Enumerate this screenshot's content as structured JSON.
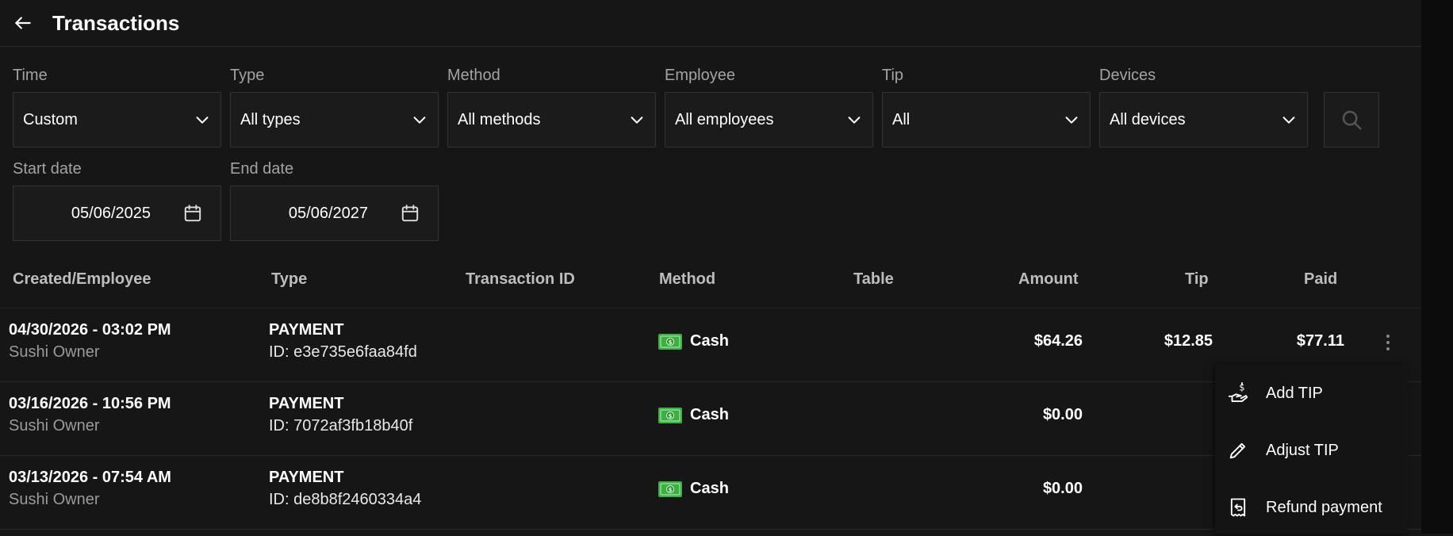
{
  "header": {
    "title": "Transactions"
  },
  "filters": [
    {
      "label": "Time",
      "value": "Custom"
    },
    {
      "label": "Type",
      "value": "All types"
    },
    {
      "label": "Method",
      "value": "All methods"
    },
    {
      "label": "Employee",
      "value": "All employees"
    },
    {
      "label": "Tip",
      "value": "All"
    },
    {
      "label": "Devices",
      "value": "All devices"
    }
  ],
  "dates": {
    "start": {
      "label": "Start date",
      "value": "05/06/2025"
    },
    "end": {
      "label": "End date",
      "value": "05/06/2027"
    }
  },
  "table": {
    "columns": [
      "Created/Employee",
      "Type",
      "Transaction ID",
      "Method",
      "Table",
      "Amount",
      "Tip",
      "Paid"
    ],
    "rows": [
      {
        "created": "04/30/2026 - 03:02 PM",
        "employee": "Sushi Owner",
        "type": "PAYMENT",
        "id": "ID: e3e735e6faa84fd",
        "method": "Cash",
        "amount": "$64.26",
        "tip": "$12.85",
        "paid": "$77.11"
      },
      {
        "created": "03/16/2026 - 10:56 PM",
        "employee": "Sushi Owner",
        "type": "PAYMENT",
        "id": "ID: 7072af3fb18b40f",
        "method": "Cash",
        "amount": "$0.00",
        "tip": "",
        "paid": ""
      },
      {
        "created": "03/13/2026 - 07:54 AM",
        "employee": "Sushi Owner",
        "type": "PAYMENT",
        "id": "ID: de8b8f2460334a4",
        "method": "Cash",
        "amount": "$0.00",
        "tip": "",
        "paid": ""
      }
    ]
  },
  "context_menu": {
    "items": [
      {
        "label": "Add TIP",
        "icon": "hand-dollar-icon"
      },
      {
        "label": "Adjust TIP",
        "icon": "pencil-icon"
      },
      {
        "label": "Refund payment",
        "icon": "receipt-refund-icon"
      }
    ]
  },
  "colors": {
    "background": "#161616",
    "border": "#333333",
    "cash_icon": "#3cb043"
  }
}
